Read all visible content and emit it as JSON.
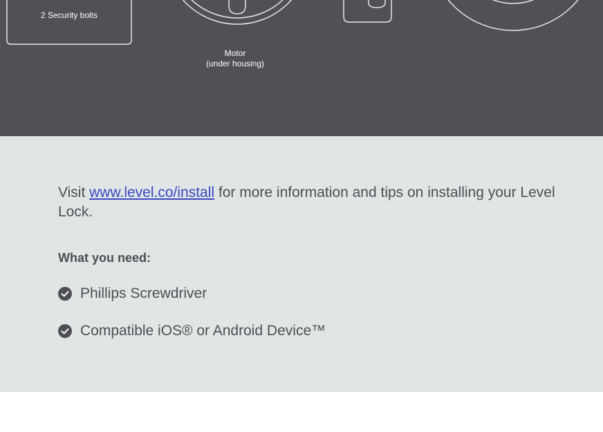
{
  "parts": {
    "bolts_label": "2 Security bolts",
    "motor_label_line1": "Motor",
    "motor_label_line2": "(under housing)"
  },
  "info": {
    "visit_prefix": "Visit ",
    "link_text": "www.level.co/install",
    "visit_suffix": " for more information and tips on installing your Level Lock."
  },
  "requirements": {
    "heading": "What you need:",
    "items": [
      {
        "label": "Phillips Screwdriver",
        "icon": "check-circle-icon"
      },
      {
        "label": "Compatible iOS® or Android Device™",
        "icon": "check-circle-icon"
      }
    ]
  },
  "colors": {
    "dark_bg": "#4f5157",
    "light_bg": "#e0e6e5",
    "text": "#4d4f53",
    "link": "#3b46c4"
  }
}
